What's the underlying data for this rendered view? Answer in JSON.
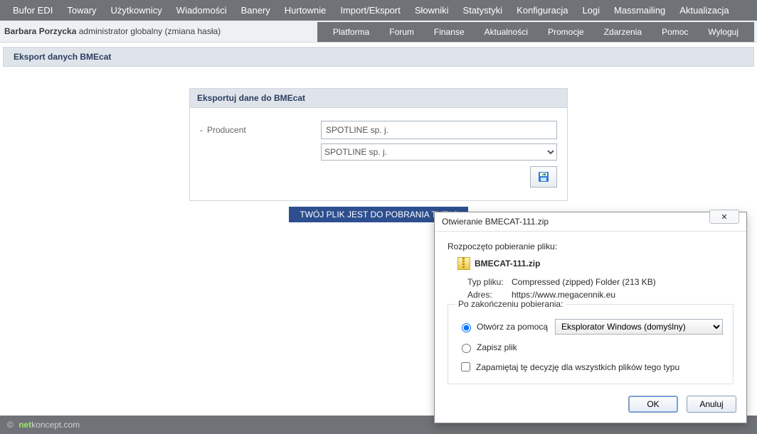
{
  "topnav": [
    "Bufor EDI",
    "Towary",
    "Użytkownicy",
    "Wiadomości",
    "Banery",
    "Hurtownie",
    "Import/Eksport",
    "Słowniki",
    "Statystyki",
    "Konfiguracja",
    "Logi",
    "Massmailing",
    "Aktualizacja"
  ],
  "user": {
    "name": "Barbara Porzycka",
    "role": "administrator globalny",
    "change_pw": "(zmiana hasła)"
  },
  "subnav": [
    "Platforma",
    "Forum",
    "Finanse",
    "Aktualności",
    "Promocje",
    "Zdarzenia",
    "Pomoc",
    "Wyloguj"
  ],
  "section_title": "Eksport danych BMEcat",
  "card": {
    "title": "Eksportuj dane do BMEcat",
    "producer_label": "Producent",
    "producer_value": "SPOTLINE sp. j.",
    "producer_select": "SPOTLINE sp. j."
  },
  "download_banner": "TWÓJ PLIK JEST DO POBRANIA TUTAJ",
  "footer": {
    "copy": "©",
    "brand1": "net",
    "brand2": "koncept.com"
  },
  "dialog": {
    "title": "Otwieranie BMECAT-111.zip",
    "started": "Rozpoczęto pobieranie pliku:",
    "filename": "BMECAT-111.zip",
    "type_k": "Typ pliku:",
    "type_v": "Compressed (zipped) Folder (213 KB)",
    "addr_k": "Adres:",
    "addr_v": "https://www.megacennik.eu",
    "after": "Po zakończeniu pobierania:",
    "open_with": "Otwórz za pomocą",
    "app": "Eksplorator Windows (domyślny)",
    "save": "Zapisz plik",
    "remember": "Zapamiętaj tę decyzję dla wszystkich plików tego typu",
    "ok": "OK",
    "cancel": "Anuluj",
    "close_glyph": "✕"
  }
}
